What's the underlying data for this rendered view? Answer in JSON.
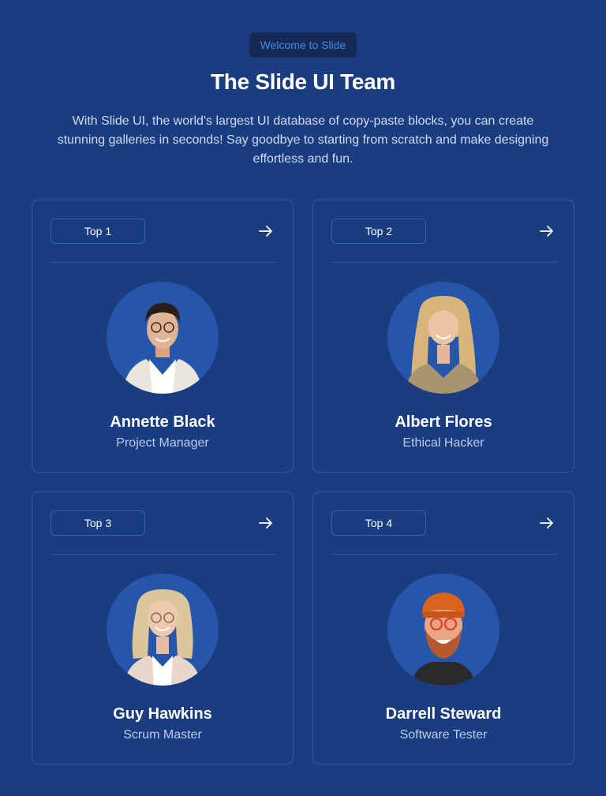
{
  "header": {
    "badge": "Welcome to Slide",
    "title": "The Slide UI Team",
    "subtitle": "With Slide UI, the world's largest UI database of copy-paste blocks, you can create stunning galleries in seconds! Say goodbye to starting from scratch and make designing effortless and fun."
  },
  "members": [
    {
      "rank": "Top 1",
      "name": "Annette Black",
      "role": "Project Manager",
      "arrow_icon": "arrow-right-icon"
    },
    {
      "rank": "Top 2",
      "name": "Albert Flores",
      "role": "Ethical Hacker",
      "arrow_icon": "arrow-right-icon"
    },
    {
      "rank": "Top 3",
      "name": "Guy Hawkins",
      "role": "Scrum Master",
      "arrow_icon": "arrow-right-icon"
    },
    {
      "rank": "Top 4",
      "name": "Darrell Steward",
      "role": "Software Tester",
      "arrow_icon": "arrow-right-icon"
    }
  ],
  "colors": {
    "background": "#1a3d80",
    "badge_bg": "#152a57",
    "badge_text": "#3f8ae8",
    "card_border": "#2f58a4",
    "avatar_bg": "#2556ac"
  }
}
